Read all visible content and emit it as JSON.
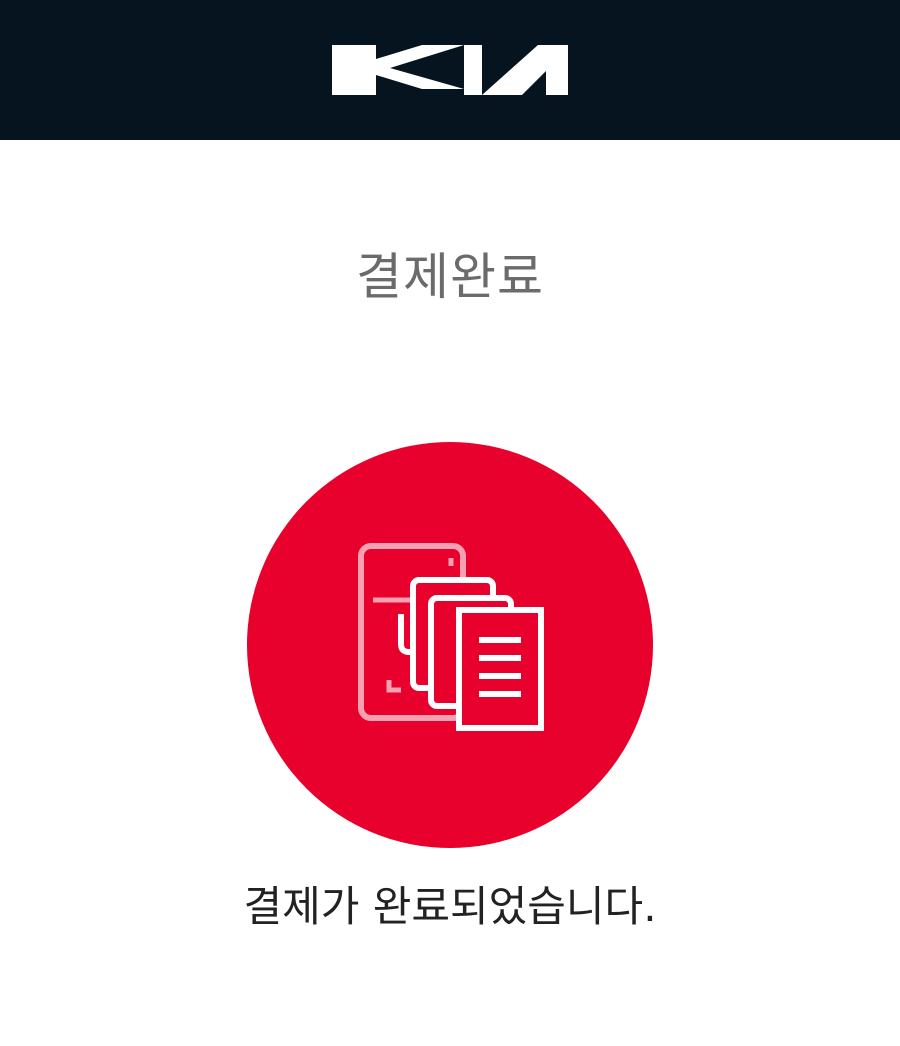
{
  "header": {
    "logo_icon": "kia-logo",
    "background_color": "#06141f"
  },
  "page": {
    "title": "결제완료"
  },
  "status": {
    "icon": "payment-documents-icon",
    "accent_color": "#e8012c",
    "message": "결제가 완료되었습니다."
  }
}
